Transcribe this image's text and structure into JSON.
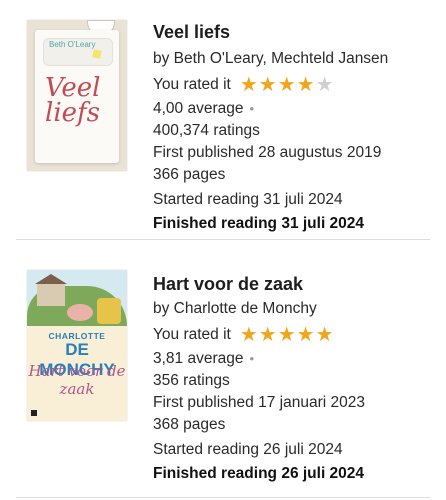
{
  "books": [
    {
      "title": "Veel liefs",
      "authors": "by Beth O'Leary, Mechteld Jansen",
      "rated_label": "You rated it",
      "rating": 4,
      "max_rating": 5,
      "average": "4,00 average",
      "ratings": "400,374 ratings",
      "first_published": "First published 28 augustus 2019",
      "pages": "366 pages",
      "started": "Started reading 31 juli 2024",
      "finished": "Finished reading 31 juli 2024",
      "cover": {
        "author_text": "Beth O'Leary",
        "title_text": "Veel liefs",
        "title_color": "#c24b56"
      }
    },
    {
      "title": "Hart voor de zaak",
      "authors": "by Charlotte de Monchy",
      "rated_label": "You rated it",
      "rating": 5,
      "max_rating": 5,
      "average": "3,81 average",
      "ratings": "356 ratings",
      "first_published": "First published 17 januari 2023",
      "pages": "368 pages",
      "started": "Started reading 26 juli 2024",
      "finished": "Finished reading 26 juli 2024",
      "cover": {
        "author_first": "CHARLOTTE",
        "author_last": "DE MONCHY",
        "title_text": "Hart voor de zaak",
        "title_color": "#b4558a"
      }
    }
  ],
  "colors": {
    "star_on": "#f2a51a",
    "star_off": "#cfcfcf",
    "divider": "#dcdcdc"
  }
}
